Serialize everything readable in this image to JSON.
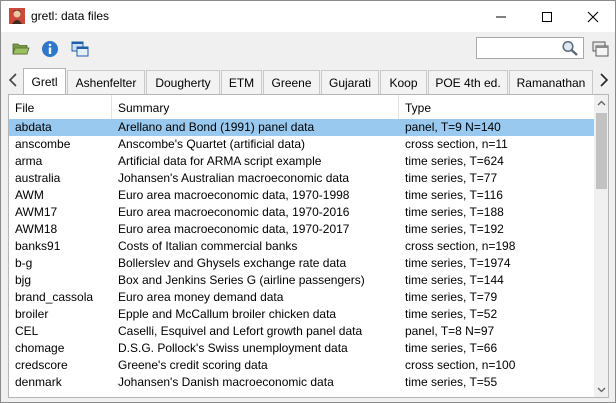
{
  "window": {
    "title": "gretl: data files",
    "controls": [
      "minimize-icon",
      "maximize-icon",
      "close-icon"
    ]
  },
  "toolbar": {
    "icons": [
      "open-folder-icon",
      "info-icon",
      "windows-icon"
    ],
    "search": {
      "value": "",
      "placeholder": ""
    },
    "search_icon": "magnifier-icon",
    "right_icon": "window-stack-icon"
  },
  "tabs": [
    {
      "label": "Gretl",
      "active": true
    },
    {
      "label": "Ashenfelter",
      "active": false
    },
    {
      "label": "Dougherty",
      "active": false
    },
    {
      "label": "ETM",
      "active": false
    },
    {
      "label": "Greene",
      "active": false
    },
    {
      "label": "Gujarati",
      "active": false
    },
    {
      "label": "Koop",
      "active": false
    },
    {
      "label": "POE 4th ed.",
      "active": false
    },
    {
      "label": "Ramanathan",
      "active": false
    }
  ],
  "table": {
    "columns": [
      "File",
      "Summary",
      "Type"
    ],
    "rows": [
      {
        "file": "abdata",
        "summary": "Arellano and Bond (1991) panel data",
        "type": "panel, T=9 N=140",
        "selected": true
      },
      {
        "file": "anscombe",
        "summary": "Anscombe's Quartet (artificial data)",
        "type": "cross section, n=11"
      },
      {
        "file": "arma",
        "summary": "Artificial data for ARMA script example",
        "type": "time series, T=624"
      },
      {
        "file": "australia",
        "summary": "Johansen's Australian macroeconomic data",
        "type": "time series, T=77"
      },
      {
        "file": "AWM",
        "summary": "Euro area macroeconomic data, 1970-1998",
        "type": "time series, T=116"
      },
      {
        "file": "AWM17",
        "summary": "Euro area macroeconomic data, 1970-2016",
        "type": "time series, T=188"
      },
      {
        "file": "AWM18",
        "summary": "Euro area macroeconomic data, 1970-2017",
        "type": "time series, T=192"
      },
      {
        "file": "banks91",
        "summary": "Costs of Italian commercial banks",
        "type": "cross section, n=198"
      },
      {
        "file": "b-g",
        "summary": "Bollerslev and Ghysels exchange rate data",
        "type": "time series, T=1974"
      },
      {
        "file": "bjg",
        "summary": "Box and Jenkins Series G (airline passengers)",
        "type": "time series, T=144"
      },
      {
        "file": "brand_cassola",
        "summary": "Euro area money demand data",
        "type": "time series, T=79"
      },
      {
        "file": "broiler",
        "summary": "Epple and McCallum broiler chicken data",
        "type": "time series, T=52"
      },
      {
        "file": "CEL",
        "summary": "Caselli, Esquivel and Lefort growth panel data",
        "type": "panel, T=8 N=97"
      },
      {
        "file": "chomage",
        "summary": "D.S.G. Pollock's Swiss unemployment data",
        "type": "time series, T=66"
      },
      {
        "file": "credscore",
        "summary": "Greene's credit scoring data",
        "type": "cross section, n=100"
      },
      {
        "file": "denmark",
        "summary": "Johansen's Danish macroeconomic data",
        "type": "time series, T=55"
      }
    ]
  },
  "colors": {
    "selection": "#99c9ef",
    "folder": "#6b8f3a",
    "info": "#2f77c9"
  }
}
